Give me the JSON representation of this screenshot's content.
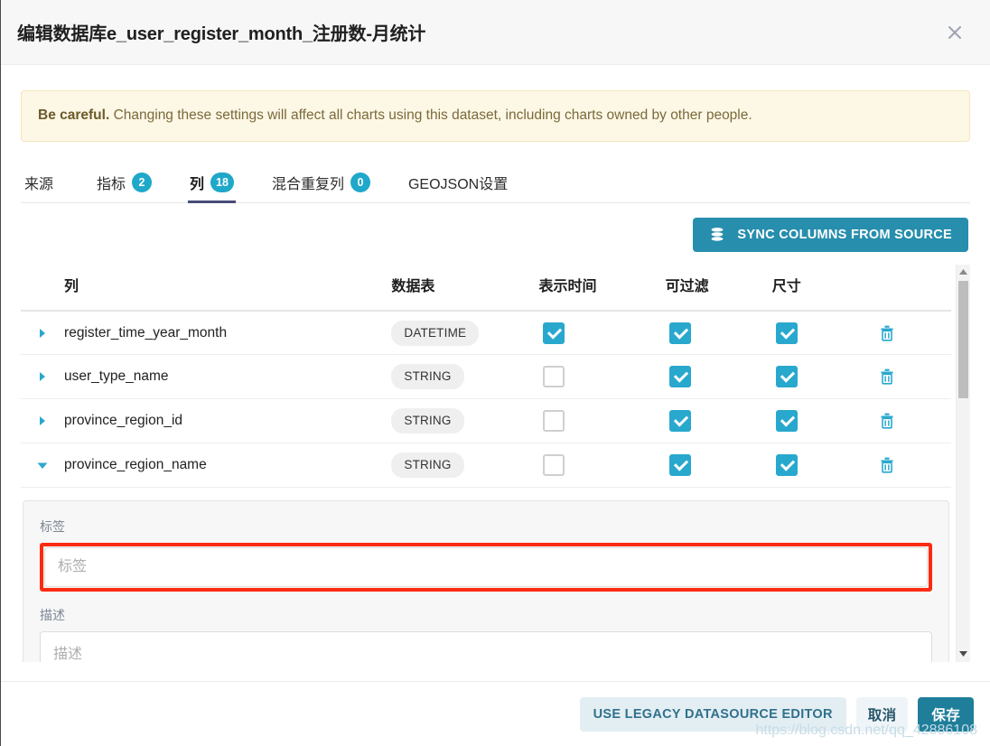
{
  "dialog": {
    "title": "编辑数据库e_user_register_month_注册数-月统计",
    "close_icon": "close-icon"
  },
  "alert": {
    "bold": "Be careful.",
    "text": " Changing these settings will affect all charts using this dataset, including charts owned by other people."
  },
  "tabs": [
    {
      "label": "来源",
      "badge": null,
      "active": false
    },
    {
      "label": "指标",
      "badge": "2",
      "active": false
    },
    {
      "label": "列",
      "badge": "18",
      "active": true
    },
    {
      "label": "混合重复列",
      "badge": "0",
      "active": false
    },
    {
      "label": "GEOJSON设置",
      "badge": null,
      "active": false
    }
  ],
  "toolbar": {
    "sync_label": "SYNC COLUMNS FROM SOURCE",
    "sync_icon": "database-icon"
  },
  "table": {
    "headers": [
      "",
      "列",
      "数据表",
      "表示时间",
      "可过滤",
      "尺寸",
      ""
    ],
    "rows": [
      {
        "expanded": false,
        "name": "register_time_year_month",
        "type": "DATETIME",
        "temporal": true,
        "filterable": true,
        "dimension": true,
        "delete_icon": "trash-icon"
      },
      {
        "expanded": false,
        "name": "user_type_name",
        "type": "STRING",
        "temporal": false,
        "filterable": true,
        "dimension": true,
        "delete_icon": "trash-icon"
      },
      {
        "expanded": false,
        "name": "province_region_id",
        "type": "STRING",
        "temporal": false,
        "filterable": true,
        "dimension": true,
        "delete_icon": "trash-icon"
      },
      {
        "expanded": true,
        "name": "province_region_name",
        "type": "STRING",
        "temporal": false,
        "filterable": true,
        "dimension": true,
        "delete_icon": "trash-icon"
      }
    ]
  },
  "detail_panel": {
    "label_field": {
      "label": "标签",
      "value": "",
      "placeholder": "标签",
      "highlighted": true
    },
    "description_field": {
      "label": "描述",
      "value": "",
      "placeholder": "描述"
    }
  },
  "scrollbar": {
    "up_icon": "caret-up-icon",
    "down_icon": "caret-down-icon"
  },
  "footer": {
    "legacy_label": "USE LEGACY DATASOURCE EDITOR",
    "cancel_label": "取消",
    "save_label": "保存"
  },
  "watermark": "https://blog.csdn.net/qq_42886108",
  "colors": {
    "accent_cyan": "#29a8ce",
    "sync_button": "#278ead",
    "save_button": "#1f7e9a",
    "active_tab_underline": "#484c7a",
    "alert_bg": "#fdf7e6",
    "highlight_red": "#fb2b13",
    "panel_bg": "#f7f7f7"
  }
}
